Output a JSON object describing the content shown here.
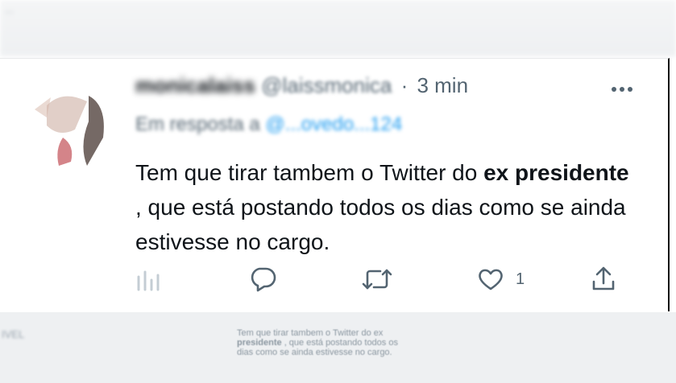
{
  "tweet": {
    "display_name": "monicalaiss",
    "handle": "@laissmonica",
    "separator": "·",
    "time": "3 min",
    "reply_prefix": "Em resposta a",
    "reply_to": "@...ovedo...124",
    "text_part1": "Tem que tirar tambem o Twitter do ",
    "text_bold": "ex presidente",
    "text_part2": " , que está postando todos os dias como se ainda estivesse no cargo.",
    "like_count": "1"
  },
  "background": {
    "top_left_text": "...",
    "bottom_left_text": "IVEL",
    "bottom_quote_line1": "Tem que tirar tambem o Twitter do ex",
    "bottom_quote_bold": "presidente",
    "bottom_quote_line2": " , que está postando todos os",
    "bottom_quote_line3": "dias como se ainda estivesse no cargo."
  },
  "icons": {
    "analytics": "analytics-icon",
    "reply": "reply-icon",
    "retweet": "retweet-icon",
    "like": "heart-icon",
    "share": "share-icon",
    "more": "more-icon"
  },
  "colors": {
    "icon_gray": "#536471",
    "link_blue": "#1d9bf0",
    "text": "#0f1419"
  }
}
